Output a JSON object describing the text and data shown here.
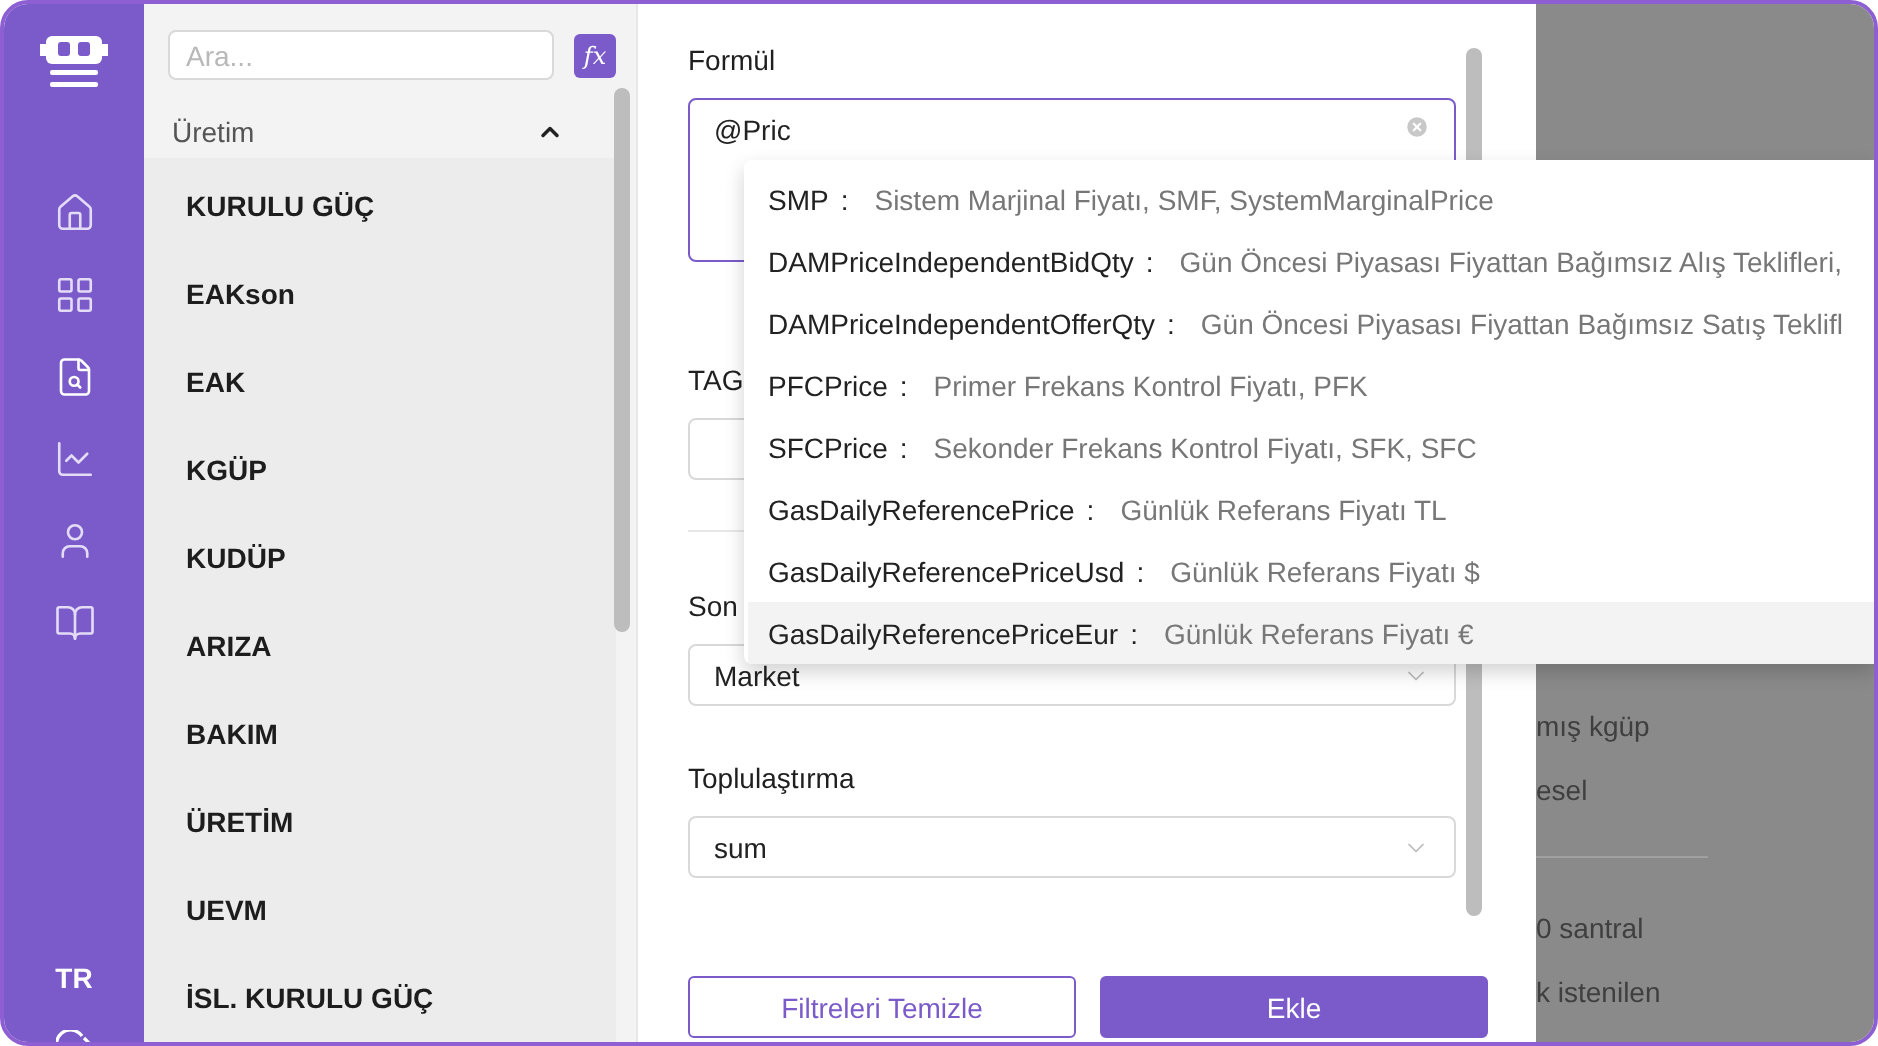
{
  "rail": {
    "language": "TR"
  },
  "sidebar": {
    "search": {
      "placeholder": "Ara..."
    },
    "formula_button": "fx",
    "section": {
      "title": "Üretim",
      "expanded": true
    },
    "items": [
      "KURULU GÜÇ",
      "EAKson",
      "EAK",
      "KGÜP",
      "KUDÜP",
      "ARIZA",
      "BAKIM",
      "ÜRETİM",
      "UEVM",
      "İSL. KURULU GÜÇ"
    ]
  },
  "form": {
    "formula": {
      "label": "Formül",
      "value": "@Pric"
    },
    "tag": {
      "label": "TAG"
    },
    "source": {
      "label": "Son",
      "value": "Market"
    },
    "aggregation": {
      "label": "Toplulaştırma",
      "value": "sum"
    },
    "buttons": [
      {
        "label": "Filtreleri Temizle",
        "kind": "outline"
      },
      {
        "label": "Ekle",
        "kind": "primary"
      }
    ]
  },
  "background_texts": [
    {
      "text": "mış kgüp",
      "kind": "line"
    },
    {
      "text": "esel",
      "kind": "line"
    },
    {
      "kind": "divider"
    },
    {
      "text": "0 santral",
      "kind": "gap"
    },
    {
      "text": "k istenilen",
      "kind": "line"
    }
  ],
  "suggestions": [
    {
      "name": "SMP",
      "separator": ":",
      "description": "Sistem Marjinal Fiyatı, SMF, SystemMarginalPrice",
      "selected": false
    },
    {
      "name": "DAMPriceIndependentBidQty",
      "separator": ":",
      "description": "Gün Öncesi Piyasası Fiyattan Bağımsız Alış Teklifleri,",
      "selected": false
    },
    {
      "name": "DAMPriceIndependentOfferQty",
      "separator": ":",
      "description": "Gün Öncesi Piyasası Fiyattan Bağımsız Satış Teklifl",
      "selected": false
    },
    {
      "name": "PFCPrice",
      "separator": ":",
      "description": "Primer Frekans Kontrol Fiyatı, PFK",
      "selected": false
    },
    {
      "name": "SFCPrice",
      "separator": ":",
      "description": "Sekonder Frekans Kontrol Fiyatı, SFK, SFC",
      "selected": false
    },
    {
      "name": "GasDailyReferencePrice",
      "separator": ":",
      "description": "Günlük Referans Fiyatı TL",
      "selected": false
    },
    {
      "name": "GasDailyReferencePriceUsd",
      "separator": ":",
      "description": "Günlük Referans Fiyatı $",
      "selected": false
    },
    {
      "name": "GasDailyReferencePriceEur",
      "separator": ":",
      "description": "Günlük Referans Fiyatı €",
      "selected": true
    }
  ]
}
